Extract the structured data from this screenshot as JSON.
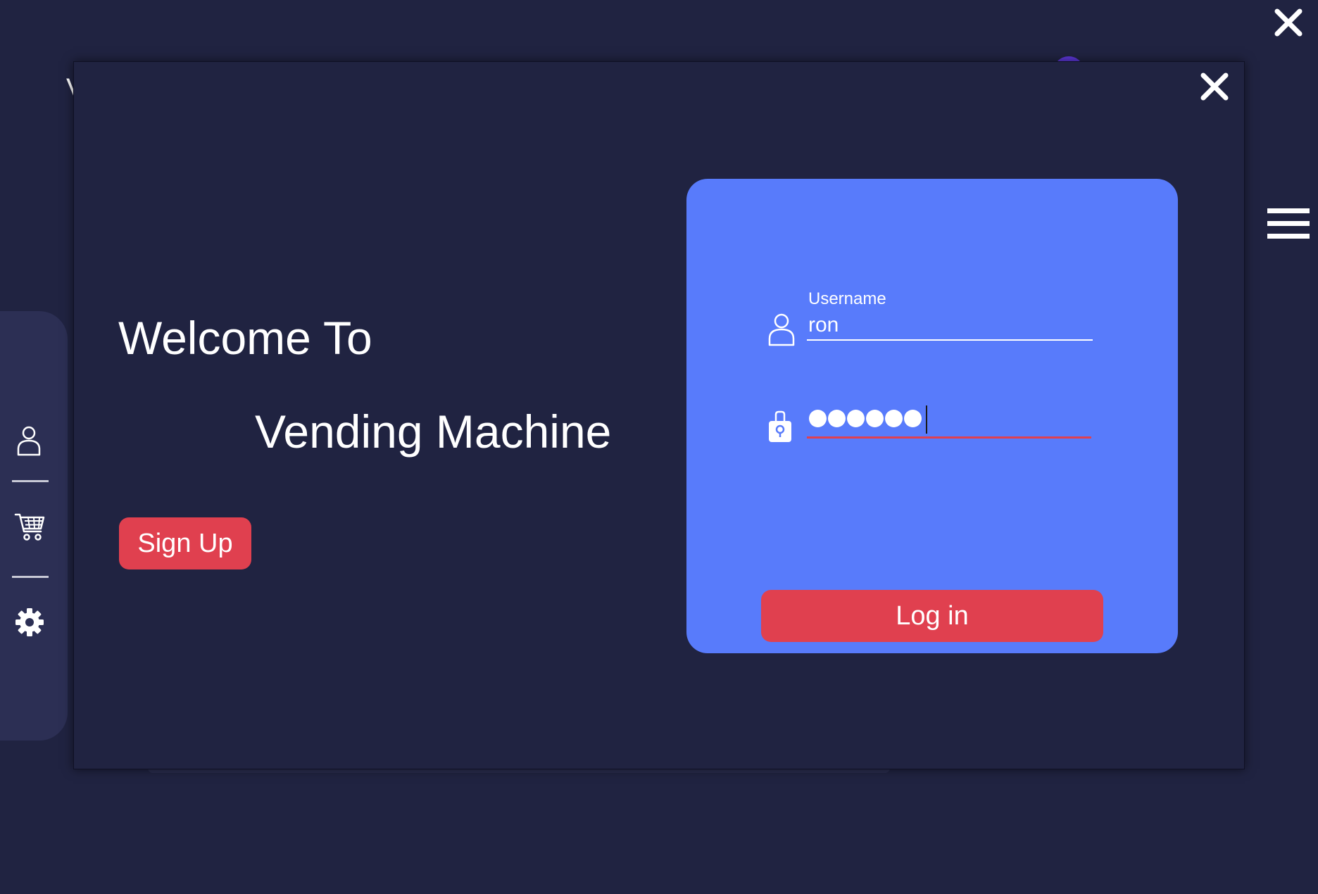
{
  "background": {
    "title_fragment": "V"
  },
  "window": {
    "close_icon": "close-icon"
  },
  "menu": {
    "icon": "hamburger-menu-icon"
  },
  "sidebar": {
    "items": [
      {
        "icon": "user-icon"
      },
      {
        "icon": "cart-icon"
      },
      {
        "icon": "gear-icon"
      }
    ]
  },
  "welcome": {
    "line1": "Welcome To",
    "line2": "Vending Machine",
    "signup_label": "Sign Up"
  },
  "login": {
    "username_label": "Username",
    "username_value": "ron",
    "password_length": 6,
    "login_label": "Log in"
  },
  "colors": {
    "background": "#202341",
    "card": "#587bfb",
    "accent": "#e0404f",
    "sidebar": "#2c2f54"
  }
}
